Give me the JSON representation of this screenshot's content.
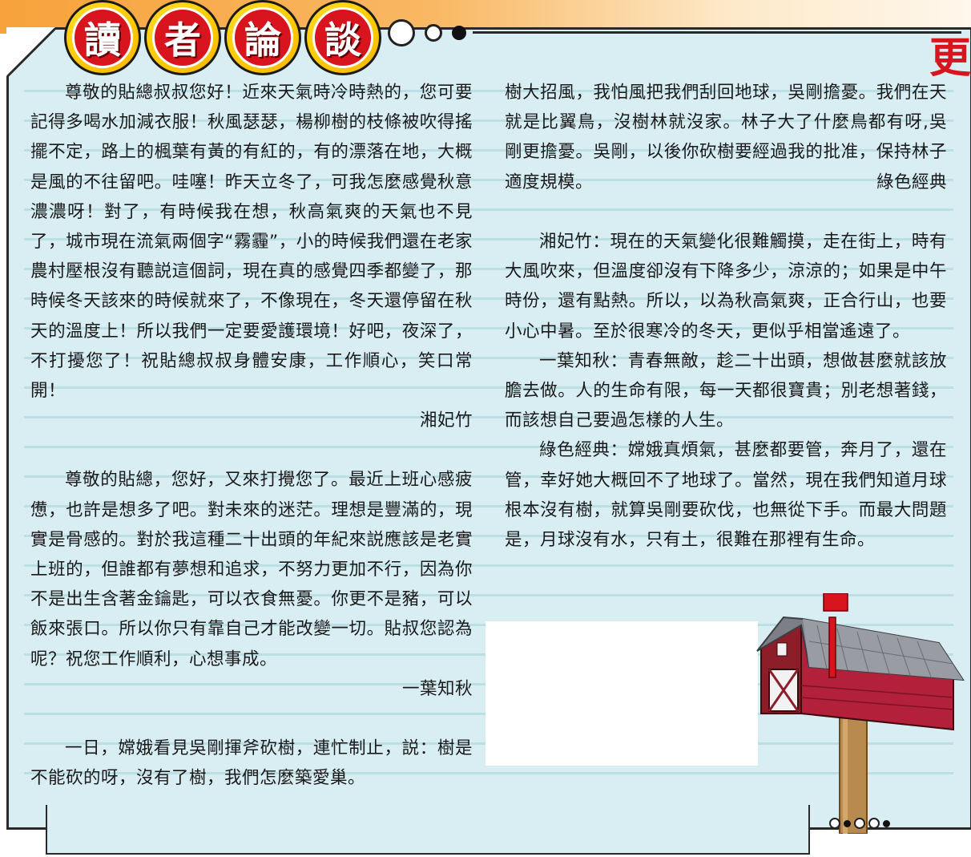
{
  "header": {
    "title_chars": [
      "讀",
      "者",
      "論",
      "談"
    ],
    "side_char": "更"
  },
  "colors": {
    "panel_bg": "#d9eef2",
    "title_red": "#d8141e",
    "title_yellow": "#ffcc00",
    "band_orange": "#f7a23b"
  },
  "left_column": {
    "letter1": {
      "text": "尊敬的貼總叔叔您好！近來天氣時冷時熱的，您可要記得多喝水加減衣服！秋風瑟瑟，楊柳樹的枝條被吹得搖擺不定，路上的楓葉有黃的有紅的，有的漂落在地，大概是風的不往留吧。哇噻！昨天立冬了，可我怎麼感覺秋意濃濃呀！對了，有時候我在想，秋高氣爽的天氣也不見了，城市現在流氣兩個字“霧霾”，小的時候我們還在老家農村壓根沒有聽説這個詞，現在真的感覺四季都變了，那時候冬天該來的時候就來了，不像現在，冬天還停留在秋天的溫度上！所以我們一定要愛護環境！好吧，夜深了，不打擾您了！祝貼總叔叔身體安康，工作順心，笑口常開！",
      "signature": "湘妃竹"
    },
    "letter2": {
      "text": "尊敬的貼總，您好，又來打攪您了。最近上班心感疲憊，也許是想多了吧。對未來的迷茫。理想是豐滿的，現實是骨感的。對於我這種二十出頭的年紀來説應該是老實上班的，但誰都有夢想和追求，不努力更加不行，因為你不是出生含著金鑰匙，可以衣食無憂。你更不是豬，可以飯來張口。所以你只有靠自己才能改變一切。貼叔您認為呢？祝您工作順利，心想事成。",
      "signature": "一葉知秋"
    },
    "letter3_start": "一日，嫦娥看見吳剛揮斧砍樹，連忙制止，説：樹是不能砍的呀，沒有了樹，我們怎麼築愛巢。"
  },
  "right_column": {
    "letter3_end": "樹大招風，我怕風把我們刮回地球，吳剛擔憂。我們在天就是比翼鳥，沒樹林就沒家。林子大了什麼鳥都有呀,吳剛更擔憂。吳剛，以後你砍樹要經過我的批准，保持林子適度規模。",
    "letter3_signature": "綠色經典",
    "reply1": "湘妃竹：現在的天氣變化很難觸摸，走在街上，時有大風吹來，但溫度卻沒有下降多少，涼涼的；如果是中午時份，還有點熱。所以，以為秋高氣爽，正合行山，也要小心中暑。至於很寒冷的冬天，更似乎相當遙遠了。",
    "reply2": "一葉知秋：青春無敵，趁二十出頭，想做甚麼就該放膽去做。人的生命有限，每一天都很寶貴；別老想著錢，而該想自己要過怎樣的人生。",
    "reply3": "綠色經典：嫦娥真煩氣，甚麼都要管，奔月了，還在管，幸好她大概回不了地球了。當然，現在我們知道月球根本沒有樹，就算吳剛要砍伐，也無從下手。而最大問題是，月球沒有水，只有土，很難在那裡有生命。"
  },
  "icons": [
    "mailbox-icon"
  ]
}
